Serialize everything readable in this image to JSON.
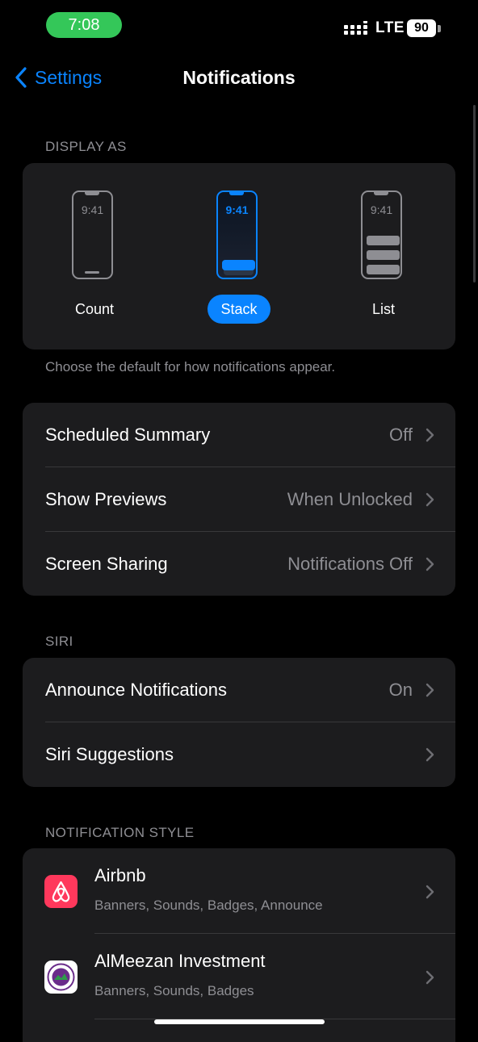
{
  "status_bar": {
    "time": "7:08",
    "network": "LTE",
    "battery": "90"
  },
  "nav": {
    "back_label": "Settings",
    "title": "Notifications"
  },
  "display_as": {
    "header": "DISPLAY AS",
    "footer": "Choose the default for how notifications appear.",
    "options": [
      {
        "label": "Count",
        "clock": "9:41"
      },
      {
        "label": "Stack",
        "clock": "9:41",
        "selected": true
      },
      {
        "label": "List",
        "clock": "9:41"
      }
    ]
  },
  "general": [
    {
      "label": "Scheduled Summary",
      "value": "Off"
    },
    {
      "label": "Show Previews",
      "value": "When Unlocked"
    },
    {
      "label": "Screen Sharing",
      "value": "Notifications Off"
    }
  ],
  "siri": {
    "header": "SIRI",
    "rows": [
      {
        "label": "Announce Notifications",
        "value": "On"
      },
      {
        "label": "Siri Suggestions",
        "value": ""
      }
    ]
  },
  "notification_style": {
    "header": "NOTIFICATION STYLE",
    "apps": [
      {
        "name": "Airbnb",
        "detail": "Banners, Sounds, Badges, Announce",
        "icon": "airbnb-logo"
      },
      {
        "name": "AlMeezan Investment",
        "detail": "Banners, Sounds, Badges",
        "icon": "almeezan-logo"
      }
    ]
  },
  "colors": {
    "accent": "#0a84ff",
    "background": "#000000",
    "group": "#1c1c1e",
    "secondary_text": "#8e8e93",
    "time_pill": "#34c759",
    "airbnb": "#ff385c"
  }
}
